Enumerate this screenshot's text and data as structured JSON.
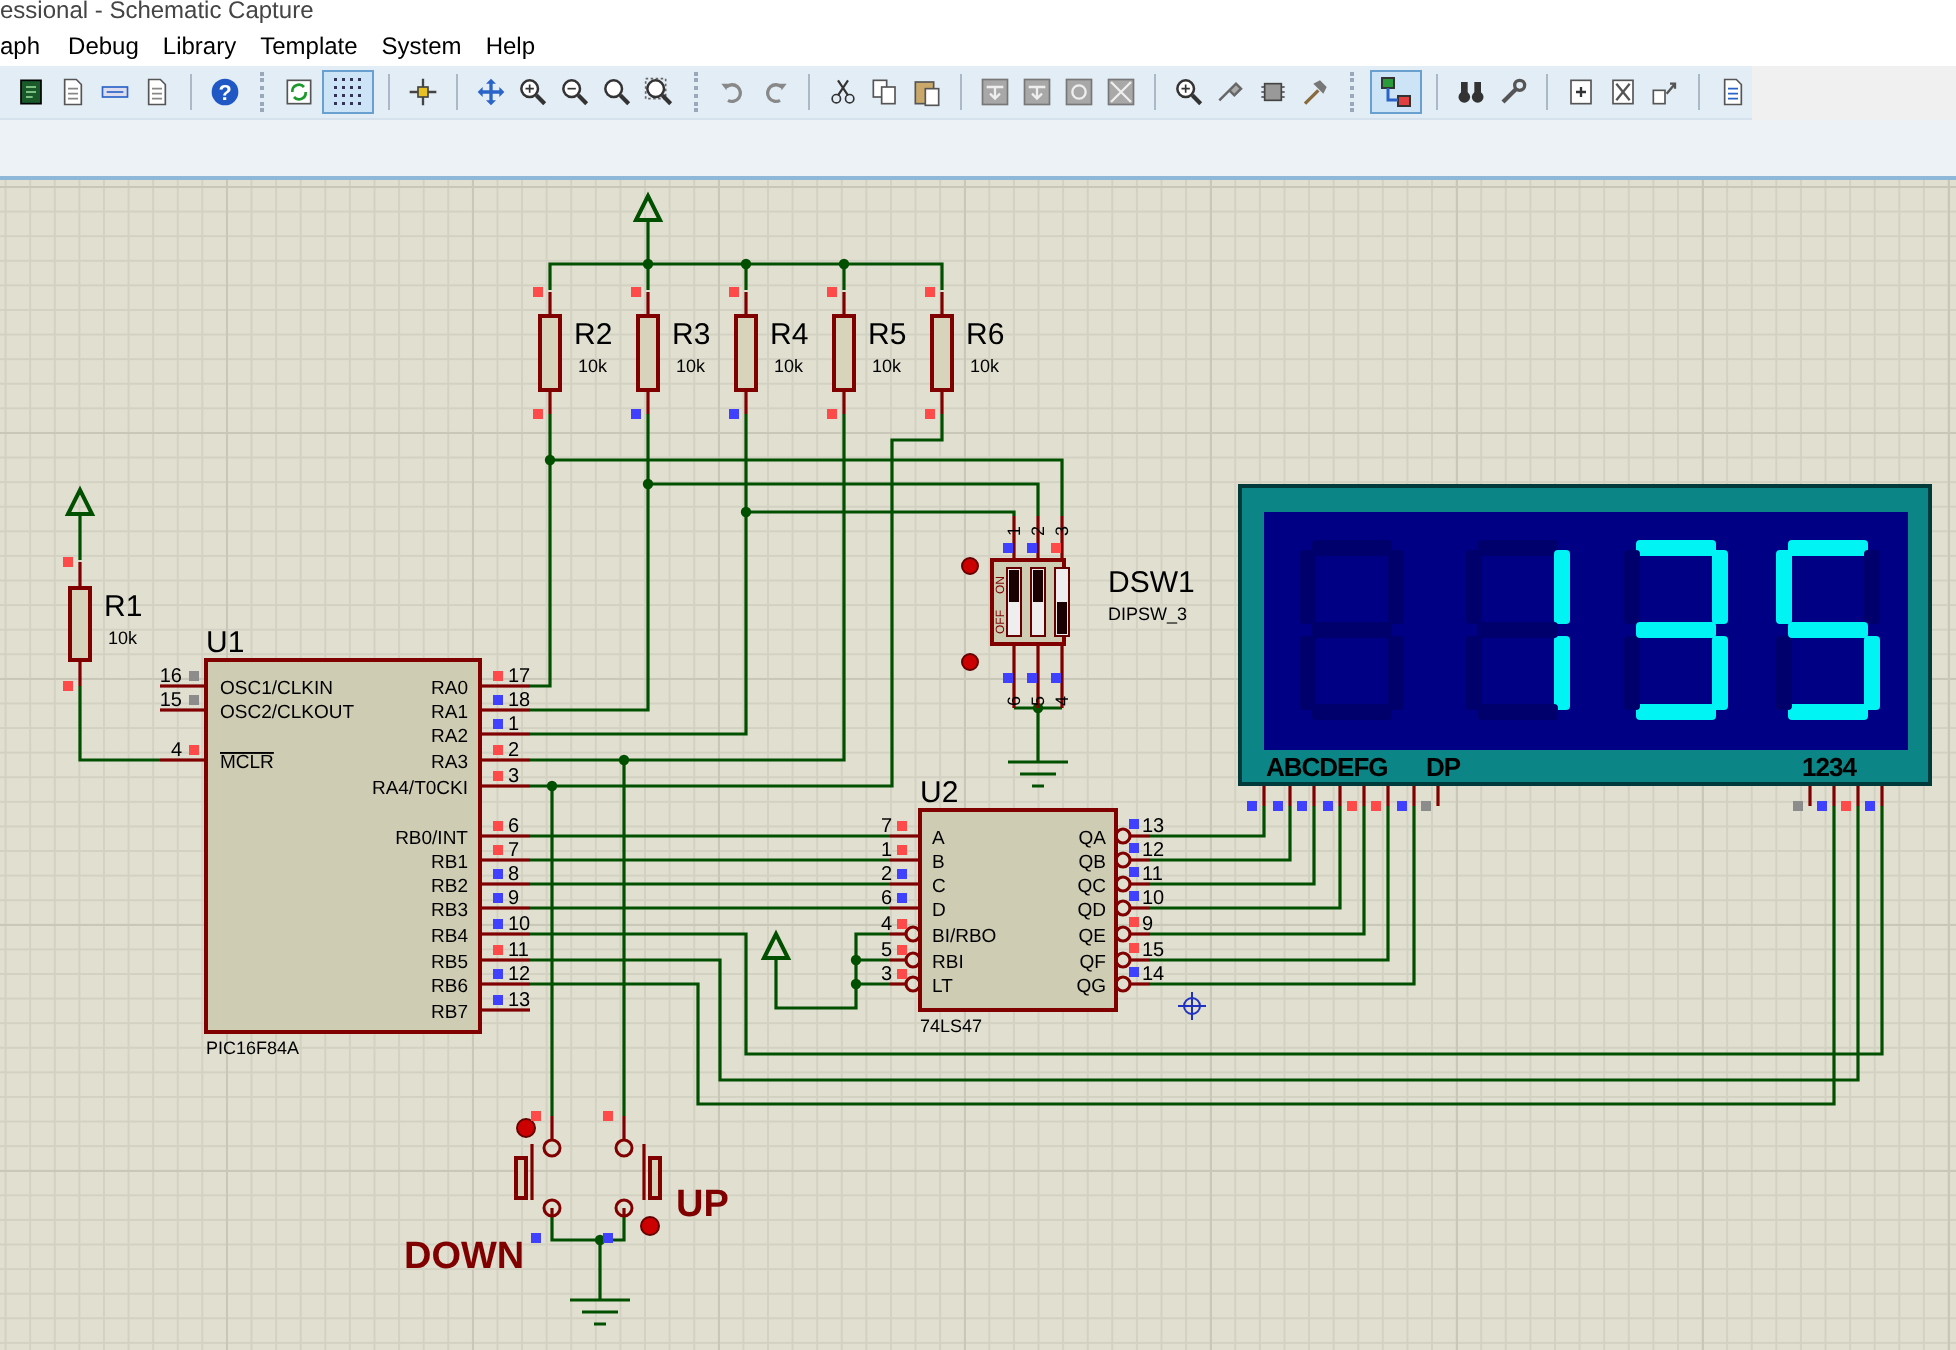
{
  "window": {
    "title": "essional - Schematic Capture"
  },
  "menu": [
    "aph",
    "Debug",
    "Library",
    "Template",
    "System",
    "Help"
  ],
  "toolbar": {
    "help_glyph": "?",
    "grid_pressed": true,
    "explorer_pressed": true
  },
  "schematic": {
    "resistors": [
      {
        "ref": "R1",
        "value": "10k",
        "pins": [
          {
            "color": "#ff4a4a"
          },
          {
            "color": "#ff4a4a"
          }
        ]
      },
      {
        "ref": "R2",
        "value": "10k",
        "pins": [
          {
            "color": "#ff4a4a"
          },
          {
            "color": "#ff4a4a"
          }
        ]
      },
      {
        "ref": "R3",
        "value": "10k",
        "pins": [
          {
            "color": "#ff4a4a"
          },
          {
            "color": "#4040ff"
          }
        ]
      },
      {
        "ref": "R4",
        "value": "10k",
        "pins": [
          {
            "color": "#ff4a4a"
          },
          {
            "color": "#4040ff"
          }
        ]
      },
      {
        "ref": "R5",
        "value": "10k",
        "pins": [
          {
            "color": "#ff4a4a"
          },
          {
            "color": "#ff4a4a"
          }
        ]
      },
      {
        "ref": "R6",
        "value": "10k",
        "pins": [
          {
            "color": "#ff4a4a"
          },
          {
            "color": "#ff4a4a"
          }
        ]
      }
    ],
    "mcu": {
      "ref": "U1",
      "part": "PIC16F84A",
      "left_pins": [
        {
          "number": "16",
          "name": "OSC1/CLKIN",
          "color": "#8c8c8c",
          "inverted": false
        },
        {
          "number": "15",
          "name": "OSC2/CLKOUT",
          "color": "#8c8c8c",
          "inverted": false
        },
        {
          "number": "4",
          "name": "MCLR",
          "color": "#ff4a4a",
          "inverted": true
        }
      ],
      "right_pins": [
        {
          "number": "17",
          "name": "RA0",
          "color": "#ff4a4a"
        },
        {
          "number": "18",
          "name": "RA1",
          "color": "#4040ff"
        },
        {
          "number": "1",
          "name": "RA2",
          "color": "#4040ff"
        },
        {
          "number": "2",
          "name": "RA3",
          "color": "#ff4a4a"
        },
        {
          "number": "3",
          "name": "RA4/T0CKI",
          "color": "#ff4a4a"
        },
        {
          "number": "6",
          "name": "RB0/INT",
          "color": "#ff4a4a"
        },
        {
          "number": "7",
          "name": "RB1",
          "color": "#ff4a4a"
        },
        {
          "number": "8",
          "name": "RB2",
          "color": "#4040ff"
        },
        {
          "number": "9",
          "name": "RB3",
          "color": "#4040ff"
        },
        {
          "number": "10",
          "name": "RB4",
          "color": "#4040ff"
        },
        {
          "number": "11",
          "name": "RB5",
          "color": "#ff4a4a"
        },
        {
          "number": "12",
          "name": "RB6",
          "color": "#4040ff"
        },
        {
          "number": "13",
          "name": "RB7",
          "color": "#4040ff"
        }
      ]
    },
    "decoder": {
      "ref": "U2",
      "part": "74LS47",
      "inputs": [
        {
          "number": "7",
          "name": "A",
          "color": "#ff4a4a",
          "inverted": false
        },
        {
          "number": "1",
          "name": "B",
          "color": "#ff4a4a",
          "inverted": false
        },
        {
          "number": "2",
          "name": "C",
          "color": "#4040ff",
          "inverted": false
        },
        {
          "number": "6",
          "name": "D",
          "color": "#4040ff",
          "inverted": false
        },
        {
          "number": "4",
          "name": "BI/RBO",
          "color": "#ff4a4a",
          "inverted": true
        },
        {
          "number": "5",
          "name": "RBI",
          "color": "#ff4a4a",
          "inverted": true
        },
        {
          "number": "3",
          "name": "LT",
          "color": "#ff4a4a",
          "inverted": true
        }
      ],
      "outputs": [
        {
          "number": "13",
          "name": "QA",
          "color": "#4040ff"
        },
        {
          "number": "12",
          "name": "QB",
          "color": "#4040ff"
        },
        {
          "number": "11",
          "name": "QC",
          "color": "#4040ff"
        },
        {
          "number": "10",
          "name": "QD",
          "color": "#4040ff"
        },
        {
          "number": "9",
          "name": "QE",
          "color": "#ff4a4a"
        },
        {
          "number": "15",
          "name": "QF",
          "color": "#ff4a4a"
        },
        {
          "number": "14",
          "name": "QG",
          "color": "#4040ff"
        }
      ]
    },
    "dip_switch": {
      "ref": "DSW1",
      "part": "DIPSW_3",
      "on_label": "ON",
      "off_label": "OFF",
      "top_pins": [
        {
          "number": "1",
          "color": "#4040ff"
        },
        {
          "number": "2",
          "color": "#4040ff"
        },
        {
          "number": "3",
          "color": "#ff4a4a"
        }
      ],
      "bottom_pins": [
        {
          "number": "6",
          "color": "#4040ff"
        },
        {
          "number": "5",
          "color": "#4040ff"
        },
        {
          "number": "4",
          "color": "#4040ff"
        }
      ],
      "switches": [
        {
          "on": true
        },
        {
          "on": true
        },
        {
          "on": false
        }
      ]
    },
    "display": {
      "segment_label": "ABCDEFG",
      "dp_label": "DP",
      "digit_label": "1234",
      "segment_pins": [
        {
          "color": "#4040ff"
        },
        {
          "color": "#4040ff"
        },
        {
          "color": "#4040ff"
        },
        {
          "color": "#4040ff"
        },
        {
          "color": "#ff4a4a"
        },
        {
          "color": "#ff4a4a"
        },
        {
          "color": "#4040ff"
        },
        {
          "color": "#8c8c8c"
        }
      ],
      "digit_pins": [
        {
          "color": "#8c8c8c"
        },
        {
          "color": "#4040ff"
        },
        {
          "color": "#ff4a4a"
        },
        {
          "color": "#4040ff"
        }
      ],
      "digits": [
        {
          "segments": [
            false,
            false,
            false,
            false,
            false,
            false,
            false
          ]
        },
        {
          "segments": [
            false,
            true,
            true,
            false,
            false,
            false,
            false
          ]
        },
        {
          "segments": [
            true,
            true,
            true,
            true,
            false,
            false,
            true
          ]
        },
        {
          "segments": [
            true,
            false,
            true,
            true,
            false,
            true,
            true
          ]
        }
      ]
    },
    "buttons": [
      {
        "label": "DOWN",
        "pins": [
          {
            "color": "#ff4a4a"
          },
          {
            "color": "#4040ff"
          }
        ]
      },
      {
        "label": "UP",
        "pins": [
          {
            "color": "#ff4a4a"
          },
          {
            "color": "#4040ff"
          }
        ]
      }
    ]
  }
}
